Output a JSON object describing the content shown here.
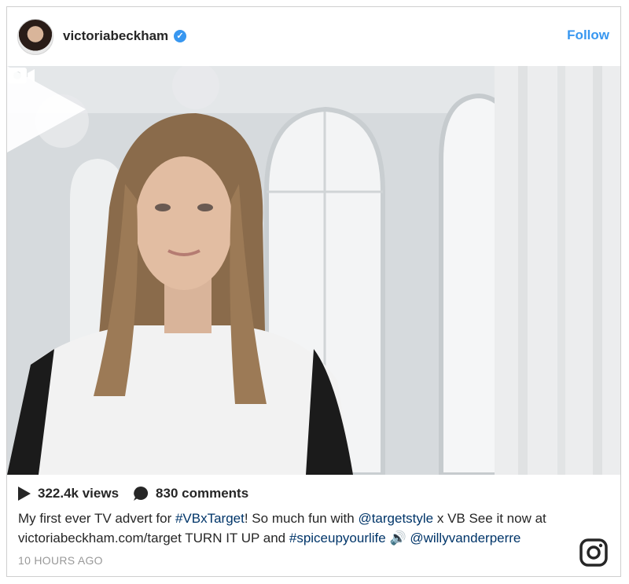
{
  "post": {
    "username": "victoriabeckham",
    "verified": true,
    "follow_label": "Follow",
    "views": "322.4k views",
    "comments": "830 comments",
    "caption": {
      "part1": "My first ever TV advert for ",
      "hashtag1": "#VBxTarget",
      "part2": "! So much fun with ",
      "mention1": "@targetstyle",
      "part3": " x VB See it now at victoriabeckham.com/target TURN IT UP and ",
      "hashtag2": "#spiceupyourlife",
      "part4": " 🔊 ",
      "mention2": "@willyvanderperre"
    },
    "timestamp": "10 HOURS AGO"
  },
  "icons": {
    "verified": "verified-badge-icon",
    "video": "video-camera-icon",
    "play": "play-icon",
    "views": "play-small-icon",
    "comments": "comment-bubble-icon",
    "instagram": "instagram-logo-icon"
  },
  "colors": {
    "link": "#3897f0",
    "hashtag": "#003569",
    "text": "#262626",
    "muted": "#999999"
  }
}
